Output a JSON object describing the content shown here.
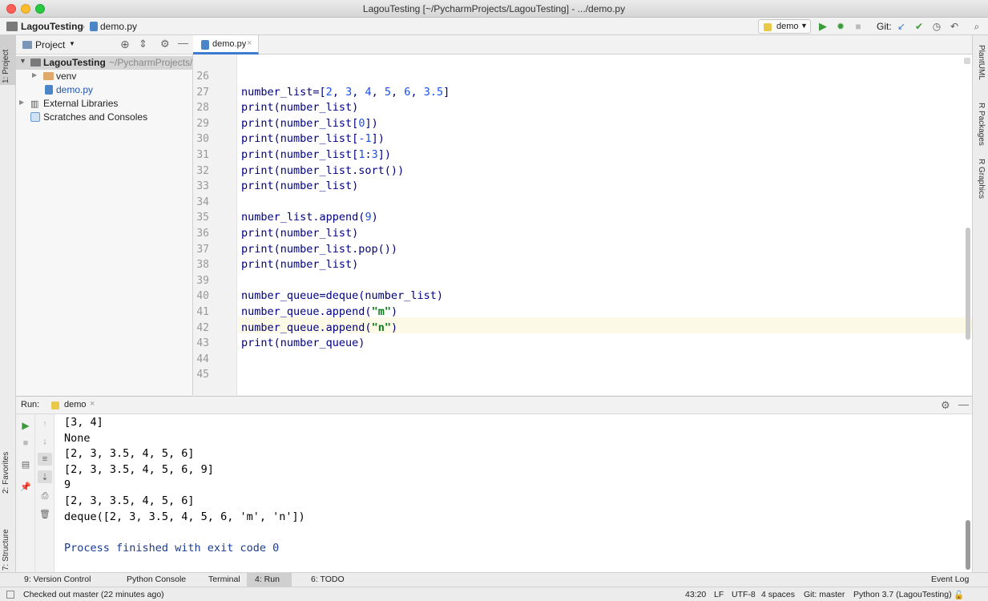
{
  "window": {
    "title": "LagouTesting [~/PycharmProjects/LagouTesting] - .../demo.py"
  },
  "navbar": {
    "project": "LagouTesting",
    "file": "demo.py",
    "run_config": "demo",
    "git_label": "Git:"
  },
  "left_stripe": {
    "project_tab": "1: Project",
    "favorites_tab": "2: Favorites",
    "structure_tab": "7: Structure"
  },
  "right_stripe": {
    "plantuml": "PlantUML",
    "r_packages": "R Packages",
    "r_graphics": "R Graphics"
  },
  "project_panel": {
    "header": "Project",
    "tree": [
      {
        "label": "LagouTesting",
        "suffix": "~/PycharmProjects/L"
      },
      {
        "label": "venv"
      },
      {
        "label": "demo.py"
      },
      {
        "label": "External Libraries"
      },
      {
        "label": "Scratches and Consoles"
      }
    ]
  },
  "editor": {
    "tab": "demo.py",
    "lines": [
      {
        "n": "26",
        "code": ""
      },
      {
        "n": "27",
        "code": "number_list=[2, 3, 4, 5, 6, 3.5]"
      },
      {
        "n": "28",
        "code": "print(number_list)"
      },
      {
        "n": "29",
        "code": "print(number_list[0])"
      },
      {
        "n": "30",
        "code": "print(number_list[-1])"
      },
      {
        "n": "31",
        "code": "print(number_list[1:3])"
      },
      {
        "n": "32",
        "code": "print(number_list.sort())"
      },
      {
        "n": "33",
        "code": "print(number_list)"
      },
      {
        "n": "34",
        "code": ""
      },
      {
        "n": "35",
        "code": "number_list.append(9)"
      },
      {
        "n": "36",
        "code": "print(number_list)"
      },
      {
        "n": "37",
        "code": "print(number_list.pop())"
      },
      {
        "n": "38",
        "code": "print(number_list)"
      },
      {
        "n": "39",
        "code": ""
      },
      {
        "n": "40",
        "code": "number_queue=deque(number_list)"
      },
      {
        "n": "41",
        "code": "number_queue.append(\"m\")"
      },
      {
        "n": "42",
        "code": "number_queue.append(\"n\")"
      },
      {
        "n": "43",
        "code": "print(number_queue)"
      },
      {
        "n": "44",
        "code": ""
      },
      {
        "n": "45",
        "code": ""
      }
    ]
  },
  "run_panel": {
    "label": "Run:",
    "tab": "demo",
    "output": [
      "[3, 4]",
      "None",
      "[2, 3, 3.5, 4, 5, 6]",
      "[2, 3, 3.5, 4, 5, 6, 9]",
      "9",
      "[2, 3, 3.5, 4, 5, 6]",
      "deque([2, 3, 3.5, 4, 5, 6, 'm', 'n'])",
      "",
      "Process finished with exit code 0"
    ]
  },
  "tool_tabs": {
    "version_control": "9: Version Control",
    "python_console": "Python Console",
    "terminal": "Terminal",
    "run": "4: Run",
    "todo": "6: TODO",
    "event_log": "Event Log"
  },
  "status": {
    "message": "Checked out master (22 minutes ago)",
    "position": "43:20",
    "line_sep": "LF",
    "encoding": "UTF-8",
    "indent": "4 spaces",
    "git": "Git: master",
    "interpreter": "Python 3.7 (LagouTesting)"
  },
  "colors": {
    "accent": "#3d7bd0",
    "run_green": "#3a9b3a",
    "keyword_num": "#1750eb",
    "string": "#067d17"
  }
}
